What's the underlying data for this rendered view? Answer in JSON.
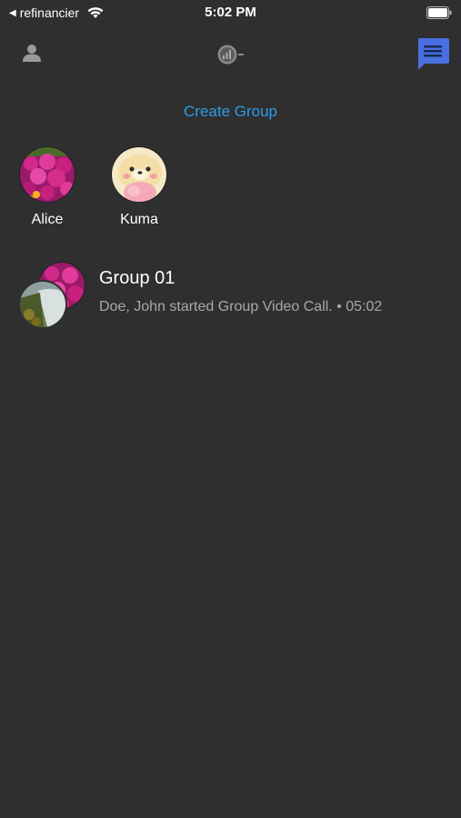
{
  "status_bar": {
    "back_app": "refinancier",
    "time": "5:02 PM"
  },
  "nav": {
    "profile_icon": "person-icon",
    "status_icon": "status-indicator-icon",
    "chat_icon": "chat-bubble-icon",
    "active_color": "#4a6fe0"
  },
  "create_group": {
    "label": "Create Group",
    "color": "#2f9be8"
  },
  "contacts": [
    {
      "name": "Alice",
      "avatar": "flowers-photo"
    },
    {
      "name": "Kuma",
      "avatar": "bear-plush-photo"
    }
  ],
  "conversations": [
    {
      "title": "Group 01",
      "preview": "Doe, John started Group Video Call.",
      "separator": "•",
      "time": "05:02"
    }
  ]
}
